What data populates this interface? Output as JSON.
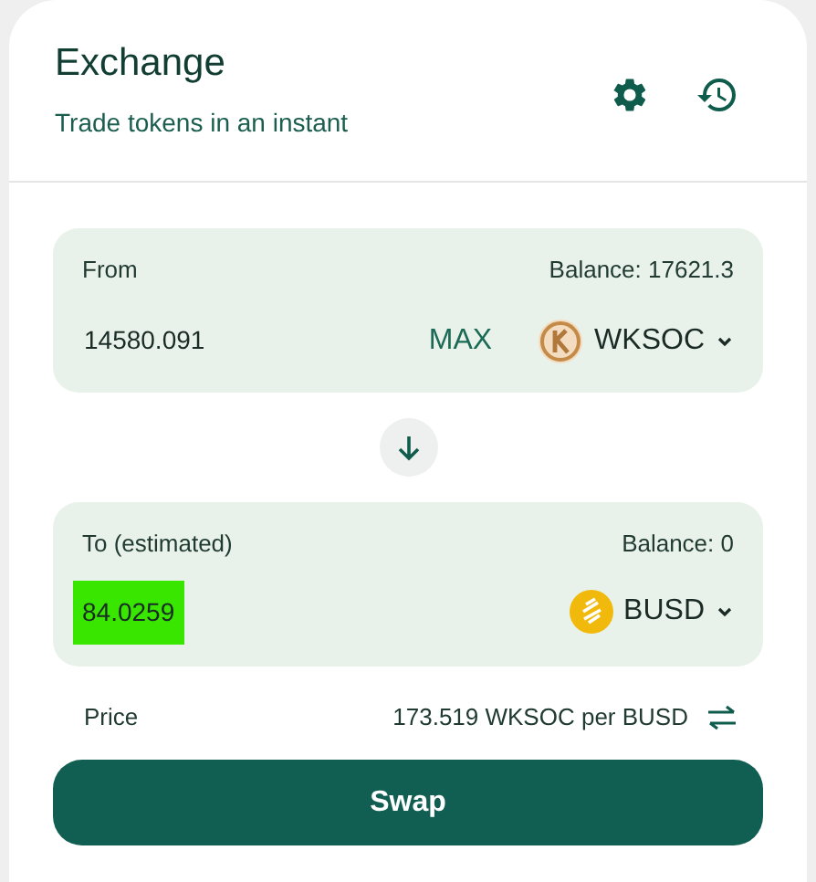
{
  "header": {
    "title": "Exchange",
    "subtitle": "Trade tokens in an instant"
  },
  "from": {
    "label": "From",
    "balance": "Balance: 17621.3",
    "amount": "14580.091",
    "max": "MAX",
    "token": "WKSOC",
    "highlighted": false
  },
  "to": {
    "label": "To (estimated)",
    "balance": "Balance: 0",
    "amount": "84.0259",
    "token": "BUSD",
    "highlighted": true
  },
  "price": {
    "label": "Price",
    "value": "173.519 WKSOC per BUSD"
  },
  "swap_button": "Swap"
}
